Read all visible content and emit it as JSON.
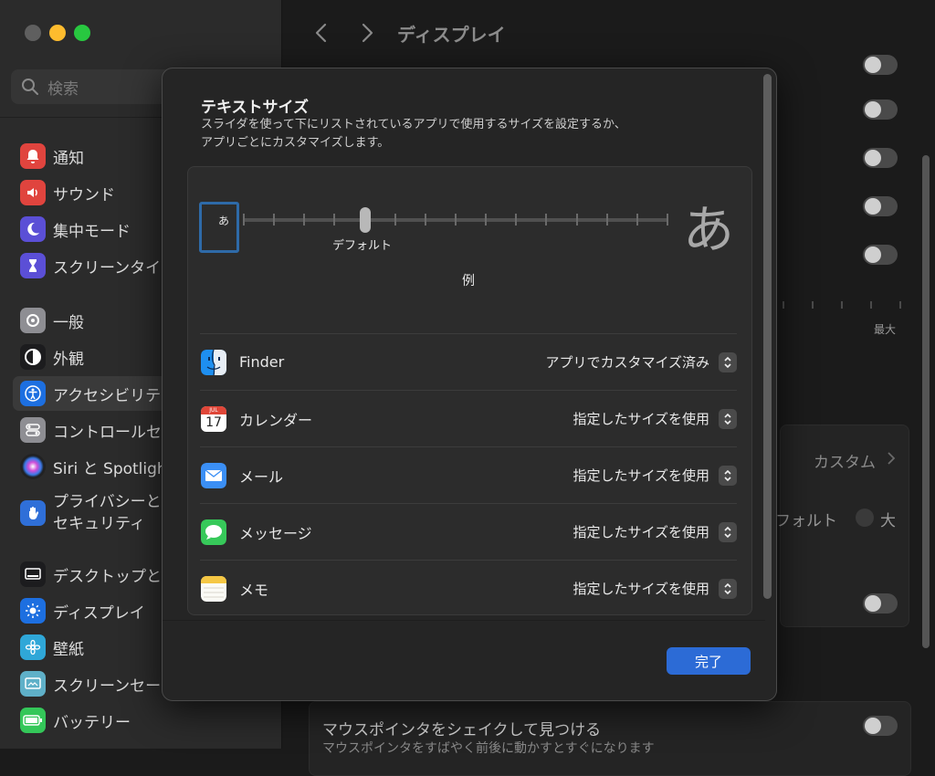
{
  "window": {
    "title": "ディスプレイ"
  },
  "sidebar": {
    "search_placeholder": "検索",
    "items": [
      {
        "label": "通知",
        "icon": "bell-icon",
        "color": "#e0443e"
      },
      {
        "label": "サウンド",
        "icon": "speaker-icon",
        "color": "#e0443e"
      },
      {
        "label": "集中モード",
        "icon": "moon-icon",
        "color": "#5b4fd6"
      },
      {
        "label": "スクリーンタイ",
        "icon": "hourglass-icon",
        "color": "#5b4fd6"
      },
      {
        "label": "一般",
        "icon": "gear-icon",
        "color": "#8e8e93"
      },
      {
        "label": "外観",
        "icon": "appearance-icon",
        "color": "#1c1c1e"
      },
      {
        "label": "アクセシビリテ",
        "icon": "accessibility-icon",
        "color": "#1d6fe0",
        "selected": true
      },
      {
        "label": "コントロールセ",
        "icon": "control-center-icon",
        "color": "#8e8e93"
      },
      {
        "label": "Siri と Spotligh",
        "icon": "siri-icon",
        "color": "#222222"
      },
      {
        "label": "プライバシーと\nセキュリティ",
        "icon": "hand-icon",
        "color": "#2f6fd8"
      },
      {
        "label": "デスクトップと",
        "icon": "desktop-icon",
        "color": "#1c1c1e"
      },
      {
        "label": "ディスプレイ",
        "icon": "sun-icon",
        "color": "#1d6fe0"
      },
      {
        "label": "壁紙",
        "icon": "wallpaper-icon",
        "color": "#2fa7d8"
      },
      {
        "label": "スクリーンセー",
        "icon": "screensaver-icon",
        "color": "#5fb0c8"
      },
      {
        "label": "バッテリー",
        "icon": "battery-icon",
        "color": "#34c759"
      }
    ]
  },
  "background": {
    "slider_max_label": "最大",
    "custom_label": "カスタム",
    "default_label": "フォルト",
    "large_label": "大",
    "shake_pointer_label": "マウスポインタをシェイクして見つける",
    "shake_pointer_desc": "マウスポインタをすばやく前後に動かすとすぐになります"
  },
  "sheet": {
    "title": "テキストサイズ",
    "description": "スライダを使って下にリストされているアプリで使用するサイズを設定するか、\nアプリごとにカスタマイズします。",
    "slider": {
      "small_glyph": "あ",
      "large_glyph": "あ",
      "default_label": "デフォルト",
      "position_index": 4,
      "tick_count": 15
    },
    "example_label": "例",
    "apps": [
      {
        "name": "Finder",
        "value": "アプリでカスタマイズ済み",
        "icon": "finder-icon"
      },
      {
        "name": "カレンダー",
        "value": "指定したサイズを使用",
        "icon": "calendar-icon",
        "icon_month": "JUL",
        "icon_day": "17"
      },
      {
        "name": "メール",
        "value": "指定したサイズを使用",
        "icon": "mail-icon"
      },
      {
        "name": "メッセージ",
        "value": "指定したサイズを使用",
        "icon": "messages-icon"
      },
      {
        "name": "メモ",
        "value": "指定したサイズを使用",
        "icon": "notes-icon"
      }
    ],
    "done_label": "完了",
    "accent": "#2c6bd6"
  }
}
